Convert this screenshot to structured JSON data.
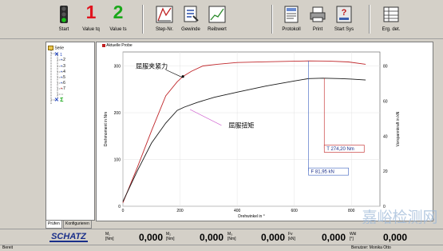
{
  "toolbar": {
    "start": "Start",
    "value_tq": "Value tq",
    "value_tq_digit": "1",
    "value_ts": "Value ts",
    "value_ts_digit": "2",
    "step_nr": "Step-Nr.",
    "gewinde": "Gewinde",
    "reibwert": "Reibwert",
    "protokoll": "Protokoll",
    "print": "Print",
    "start_sys": "Start Sys",
    "erg_det": "Erg. det."
  },
  "tree": {
    "root": "Serie",
    "items": [
      "1",
      "2",
      "3",
      "4",
      "5",
      "6",
      "7"
    ]
  },
  "tabs": [
    "Prüfen",
    "Konfigurieren"
  ],
  "panel": {
    "title": "Aktuelle Probe"
  },
  "chart_data": {
    "type": "line",
    "xlabel": "Drehwinkel in °",
    "ylabel": "Drehmoment in Nm",
    "y2label": "Vorspannkraft in kN",
    "xlim": [
      0,
      900
    ],
    "ylim": [
      0,
      330
    ],
    "y2lim": [
      0,
      88
    ],
    "xticks": [
      0,
      200,
      400,
      600,
      800
    ],
    "yticks": [
      0,
      100,
      200,
      300
    ],
    "y2ticks": [
      0,
      20,
      40,
      60,
      80
    ],
    "series": [
      {
        "axis": "right",
        "color": "#c0282c",
        "x": [
          0,
          50,
          100,
          150,
          190,
          210,
          240,
          280,
          330,
          400,
          500,
          600,
          650,
          720,
          790,
          850
        ],
        "y": [
          2,
          22,
          43,
          63,
          71,
          74,
          77,
          80,
          81,
          82,
          82.4,
          82.7,
          82.9,
          82.8,
          82.3,
          81.0
        ]
      },
      {
        "axis": "left",
        "color": "#1a1a1a",
        "x": [
          0,
          50,
          100,
          150,
          190,
          215,
          260,
          320,
          400,
          500,
          600,
          650,
          700,
          760,
          800,
          850
        ],
        "y": [
          10,
          75,
          135,
          178,
          205,
          212,
          222,
          233,
          244,
          257,
          268,
          273,
          274,
          273,
          272,
          270
        ]
      }
    ],
    "annotations": [
      {
        "text": "屈服夹紧力",
        "color": "#000000"
      },
      {
        "text": "屈服扭矩",
        "color": "#000000"
      }
    ],
    "markers": [
      {
        "label": "T",
        "value": "274,20 Nm"
      },
      {
        "label": "F",
        "value": "81,95 kN"
      }
    ]
  },
  "readout": {
    "logo": "SCHATZ",
    "fields": [
      {
        "key": "M₁\n[Nm]",
        "value": "0,000"
      },
      {
        "key": "M₂\n[Nm]",
        "value": "0,000"
      },
      {
        "key": "M₃\n[Nm]",
        "value": "0,000"
      },
      {
        "key": "Fv\n[kN]",
        "value": "0,000"
      },
      {
        "key": "Wkl\n[°]",
        "value": "0,000"
      }
    ]
  },
  "status": {
    "left": "Bereit",
    "right": "Benutzer: Monika Otto"
  },
  "watermark": "嘉峪检测网"
}
